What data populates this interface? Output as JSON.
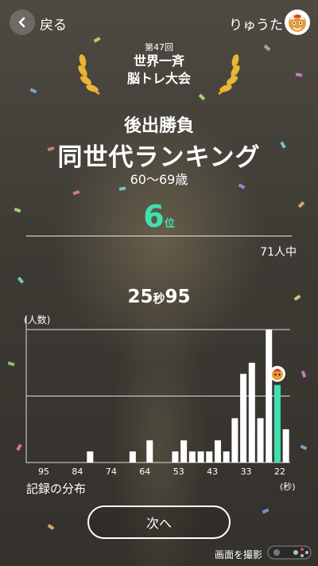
{
  "topbar": {
    "back_label": "戻る",
    "user_name": "りゅうた"
  },
  "header": {
    "edition": "第47回",
    "event_line1": "世界一斉",
    "event_line2": "脳トレ大会",
    "subtitle": "後出勝負",
    "title": "同世代ランキング",
    "age_range": "60〜69歳"
  },
  "result": {
    "rank": "6",
    "rank_unit": "位",
    "total": "71人中",
    "time_main": "25",
    "time_unit": "秒",
    "time_frac": "95",
    "accent": "#3fe0b0"
  },
  "chart_data": {
    "type": "bar",
    "title": "",
    "ylabel": "(人数)",
    "xunit": "(秒)",
    "xlabel": "記録の分布",
    "tick_labels": [
      "95",
      "84",
      "74",
      "64",
      "53",
      "43",
      "33",
      "22"
    ],
    "values": [
      0,
      0,
      0,
      0,
      0,
      0,
      0,
      1,
      0,
      0,
      0,
      0,
      1,
      0,
      2,
      0,
      0,
      1,
      2,
      1,
      1,
      1,
      2,
      1,
      4,
      8,
      9,
      4,
      12,
      7,
      3
    ],
    "highlight_index": 29,
    "ymax": 12,
    "gridlines": [
      6,
      12
    ],
    "player_marker": "avatar"
  },
  "footer": {
    "distribution_label": "記録の分布",
    "next_button": "次へ",
    "capture_label": "画面を撮影"
  }
}
